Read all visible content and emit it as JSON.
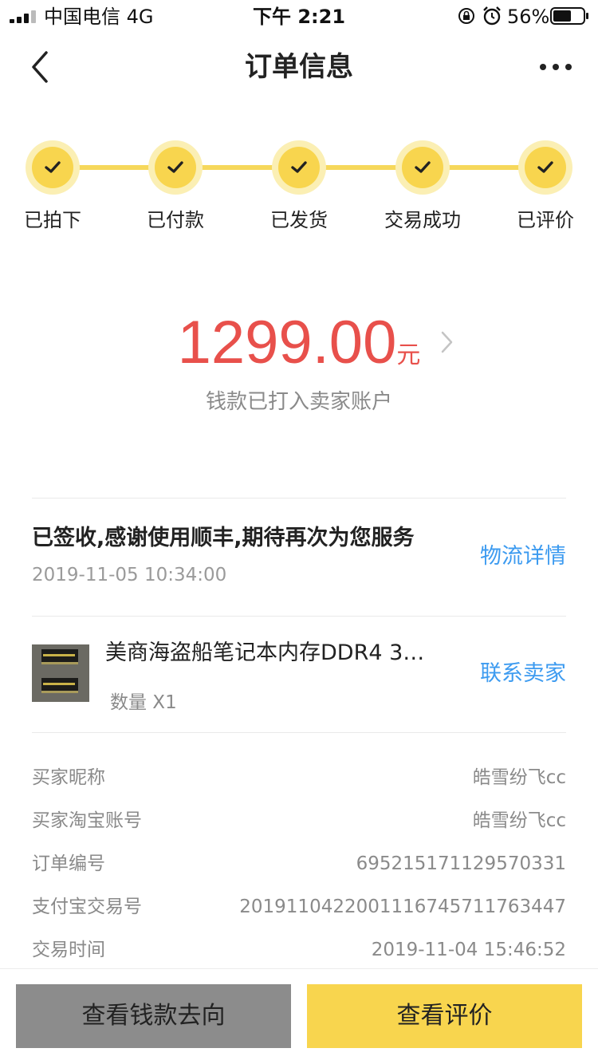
{
  "status_bar": {
    "carrier": "中国电信  4G",
    "time": "下午 2:21",
    "battery": "56%"
  },
  "nav": {
    "title": "订单信息",
    "back_icon": "chevron-left-icon",
    "more_icon": "more-horizontal-icon"
  },
  "progress": {
    "steps": [
      {
        "label": "已拍下",
        "done": true
      },
      {
        "label": "已付款",
        "done": true
      },
      {
        "label": "已发货",
        "done": true
      },
      {
        "label": "交易成功",
        "done": true
      },
      {
        "label": "已评价",
        "done": true
      }
    ]
  },
  "amount": {
    "value": "1299.00",
    "currency": "元",
    "note": "钱款已打入卖家账户"
  },
  "logistics": {
    "status": "已签收,感谢使用顺丰,期待再次为您服务",
    "time": "2019-11-05 10:34:00",
    "link": "物流详情"
  },
  "product": {
    "title": "美商海盗船笔记本内存DDR4 3…",
    "quantity": "数量 X1",
    "contact": "联系卖家"
  },
  "info": [
    {
      "key": "买家昵称",
      "value": "皓雪纷飞cc"
    },
    {
      "key": "买家淘宝账号",
      "value": "皓雪纷飞cc"
    },
    {
      "key": "订单编号",
      "value": "695215171129570331"
    },
    {
      "key": "支付宝交易号",
      "value": "2019110422001116745711763447"
    },
    {
      "key": "交易时间",
      "value": "2019-11-04 15:46:52"
    }
  ],
  "actions": {
    "funds_flow": "查看钱款去向",
    "view_review": "查看评价"
  },
  "colors": {
    "accent_yellow": "#f8d54e",
    "price_red": "#e8504b",
    "link_blue": "#3d9bf0",
    "grey_button": "#8c8c8c"
  }
}
